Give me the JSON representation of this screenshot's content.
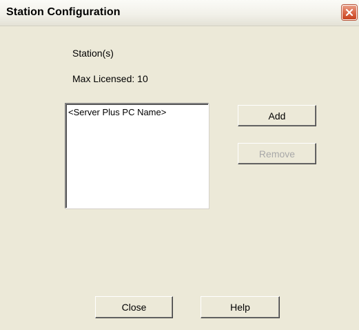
{
  "window": {
    "title": "Station Configuration"
  },
  "labels": {
    "stations": "Station(s)",
    "max_licensed": "Max Licensed: 10"
  },
  "stations_list": {
    "items": [
      "<Server Plus PC Name>"
    ]
  },
  "buttons": {
    "add": "Add",
    "remove": "Remove",
    "close": "Close",
    "help": "Help"
  },
  "icons": {
    "close": "close-icon"
  },
  "colors": {
    "close_button": "#dc6d4f",
    "window_background": "#ece9d8",
    "disabled_text": "#a8a8a8"
  }
}
